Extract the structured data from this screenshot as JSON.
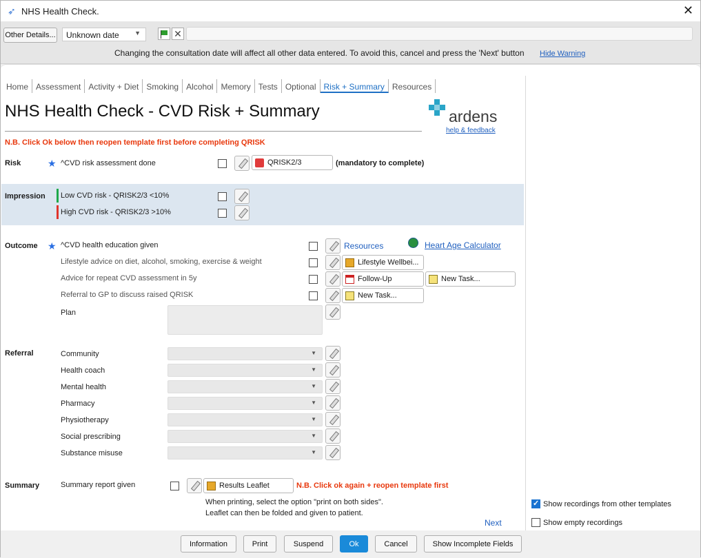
{
  "window": {
    "title": "NHS Health Check."
  },
  "datebar": {
    "other_details": "Other Details...",
    "date_value": "Unknown date",
    "warning": "Changing the consultation date will affect all other data entered. To avoid this, cancel and press the 'Next' button",
    "hide_warning": "Hide Warning"
  },
  "tabs": [
    "Home",
    "Assessment",
    "Activity + Diet",
    "Smoking",
    "Alcohol",
    "Memory",
    "Tests",
    "Optional",
    "Risk + Summary",
    "Resources"
  ],
  "active_tab": "Risk + Summary",
  "page": {
    "title": "NHS Health Check - CVD Risk + Summary",
    "logo_text": "ardens",
    "help_link": "help & feedback",
    "note": "N.B. Click Ok below then reopen template first before completing QRISK"
  },
  "risk": {
    "section": "Risk",
    "item": "^CVD risk assessment done",
    "qrisk_button": "QRISK2/3",
    "mandatory": "(mandatory to complete)"
  },
  "impression": {
    "section": "Impression",
    "low": "Low CVD risk - QRISK2/3 <10%",
    "high": "High CVD risk - QRISK2/3 >10%"
  },
  "outcome": {
    "section": "Outcome",
    "items": [
      "^CVD health education given",
      "Lifestyle advice on diet, alcohol, smoking, exercise & weight",
      "Advice for repeat CVD assessment in 5y",
      "Referral to GP to discuss raised QRISK"
    ],
    "resources_link": "Resources",
    "heart_age_link": "Heart Age Calculator",
    "lifestyle_button": "Lifestyle Wellbei...",
    "followup_button": "Follow-Up",
    "new_task_1": "New Task...",
    "new_task_2": "New Task...",
    "plan_label": "Plan"
  },
  "referral": {
    "section": "Referral",
    "items": [
      "Community",
      "Health coach",
      "Mental health",
      "Pharmacy",
      "Physiotherapy",
      "Social prescribing",
      "Substance misuse"
    ]
  },
  "summary": {
    "section": "Summary",
    "item": "Summary report given",
    "leaflet_button": "Results Leaflet",
    "note": "N.B. Click ok again + reopen template first",
    "print_note_1": "When printing, select the option \"print on both sides\".",
    "print_note_2": "Leaflet can then be folded and given to patient."
  },
  "next_link": "Next",
  "right_panel": {
    "show_recordings": "Show recordings from other templates",
    "show_recordings_checked": true,
    "show_empty": "Show empty recordings",
    "show_empty_checked": false
  },
  "buttons": {
    "information": "Information",
    "print": "Print",
    "suspend": "Suspend",
    "ok": "Ok",
    "cancel": "Cancel",
    "show_incomplete": "Show Incomplete Fields"
  },
  "colors": {
    "accent": "#1d6fc4",
    "warning": "#e8380d",
    "band": "#dce6f0",
    "logo": "#2aa5c8"
  }
}
